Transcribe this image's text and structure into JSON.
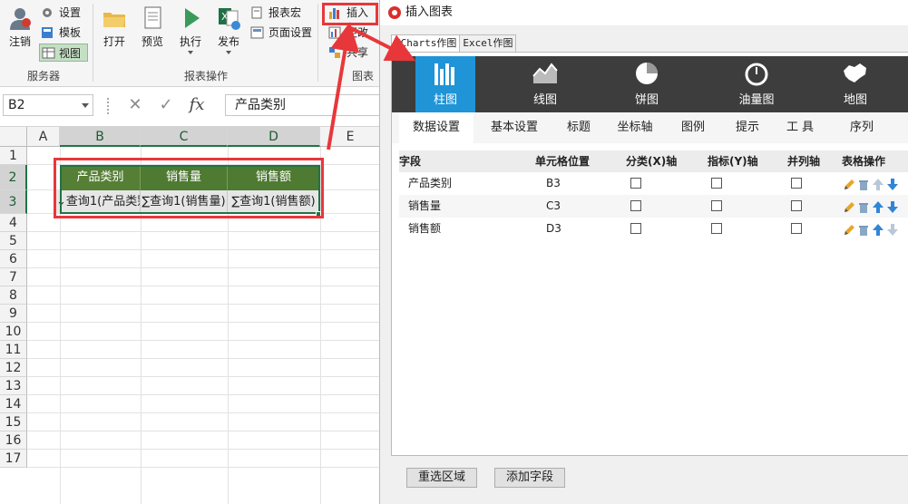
{
  "ribbon": {
    "logout": "注销",
    "settings": "设置",
    "template": "模板",
    "view": "视图",
    "service_group": "服务器",
    "open": "打开",
    "preview": "预览",
    "run": "执行",
    "publish": "发布",
    "macro": "报表宏",
    "page_setup": "页面设置",
    "report_group": "报表操作",
    "insert": "插入",
    "change": "更改",
    "share": "共享",
    "chart_group": "图表"
  },
  "formula_bar": {
    "name_box": "B2",
    "content": "产品类别",
    "cancel": "✕",
    "confirm": "✓",
    "fx": "fx"
  },
  "sheet": {
    "columns": [
      "A",
      "B",
      "C",
      "D",
      "E"
    ],
    "rows": [
      "1",
      "2",
      "3",
      "4",
      "5",
      "6",
      "7",
      "8",
      "9",
      "10",
      "11",
      "12",
      "13",
      "14",
      "15",
      "16",
      "17"
    ],
    "header_cells": [
      "产品类别",
      "销售量",
      "销售额"
    ],
    "data_cells": [
      "↓查询1(产品类别",
      "∑查询1(销售量)",
      "∑查询1(销售额)"
    ]
  },
  "dialog": {
    "title": "插入图表",
    "tabs": [
      "ECharts作图",
      "Excel作图"
    ],
    "chart_types": [
      "柱图",
      "线图",
      "饼图",
      "油量图",
      "地图"
    ],
    "sub_tabs": [
      "数据设置",
      "基本设置",
      "标题",
      "坐标轴",
      "图例",
      "提示",
      "工具",
      "序列"
    ],
    "table_headers": [
      "字段",
      "单元格位置",
      "分类(X)轴",
      "指标(Y)轴",
      "并列轴",
      "表格操作"
    ],
    "rows": [
      {
        "field": "产品类别",
        "cell": "B3"
      },
      {
        "field": "销售量",
        "cell": "C3"
      },
      {
        "field": "销售额",
        "cell": "D3"
      }
    ],
    "reselect_button": "重选区域",
    "add_field_button": "添加字段"
  },
  "colors": {
    "accent_green": "#217346",
    "header_green": "#4e7a32",
    "highlight_red": "#e8373a",
    "chart_active_blue": "#1f94d7",
    "chart_bar_bg": "#3d3d3d"
  }
}
